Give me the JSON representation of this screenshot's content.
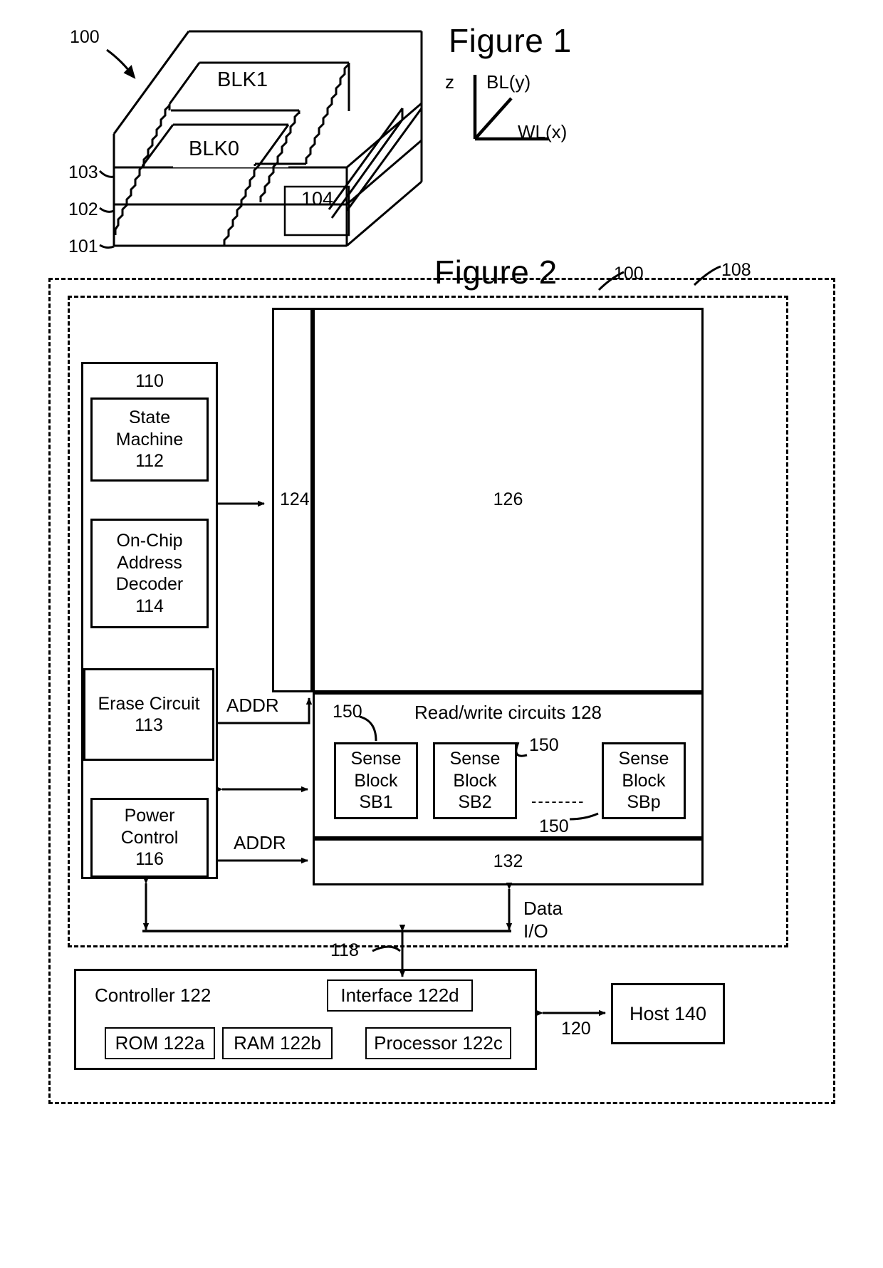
{
  "figure1": {
    "title": "Figure 1",
    "device_ref": "100",
    "blocks": [
      {
        "label": "BLK1"
      },
      {
        "label": "BLK0"
      }
    ],
    "layer_refs": [
      "103",
      "102",
      "101"
    ],
    "substrate_ref": "104",
    "axes": {
      "z": "z",
      "bitline": "BL(y)",
      "wordline": "WL(x)"
    }
  },
  "figure2": {
    "title": "Figure 2",
    "memory_device_ref": "100",
    "die_ref": "108",
    "control_circuitry": {
      "ref": "110",
      "blocks": [
        {
          "name": "state-machine",
          "label": "State\nMachine\n112",
          "lines": [
            "State",
            "Machine",
            "112"
          ]
        },
        {
          "name": "on-chip-address-decoder",
          "label": "On-Chip\nAddress\nDecoder\n114",
          "lines": [
            "On-Chip",
            "Address",
            "Decoder",
            "114"
          ]
        },
        {
          "name": "erase-circuit",
          "label": "Erase Circuit\n113",
          "lines": [
            "Erase Circuit",
            "113"
          ]
        },
        {
          "name": "power-control",
          "label": "Power\nControl\n116",
          "lines": [
            "Power",
            "Control",
            "116"
          ]
        }
      ]
    },
    "row_decoder_ref": "124",
    "memory_array_ref": "126",
    "read_write_circuits": {
      "title": "Read/write circuits 128",
      "callout_refs": [
        "150",
        "150",
        "150"
      ],
      "sense_blocks": [
        {
          "lines": [
            "Sense",
            "Block",
            "SB1"
          ]
        },
        {
          "lines": [
            "Sense",
            "Block",
            "SB2"
          ]
        },
        {
          "lines": [
            "Sense",
            "Block",
            "SBp"
          ]
        }
      ],
      "ellipsis": "- - - - - - - -"
    },
    "column_decoder_ref": "132",
    "signals": {
      "addr_upper": "ADDR",
      "addr_lower": "ADDR",
      "data_io_line1": "Data",
      "data_io_line2": "I/O",
      "bus_ref": "118",
      "host_link_ref": "120"
    },
    "controller": {
      "title": "Controller 122",
      "interface": "Interface 122d",
      "rom": "ROM 122a",
      "ram": "RAM 122b",
      "processor": "Processor 122c"
    },
    "host": {
      "label": "Host 140"
    }
  }
}
